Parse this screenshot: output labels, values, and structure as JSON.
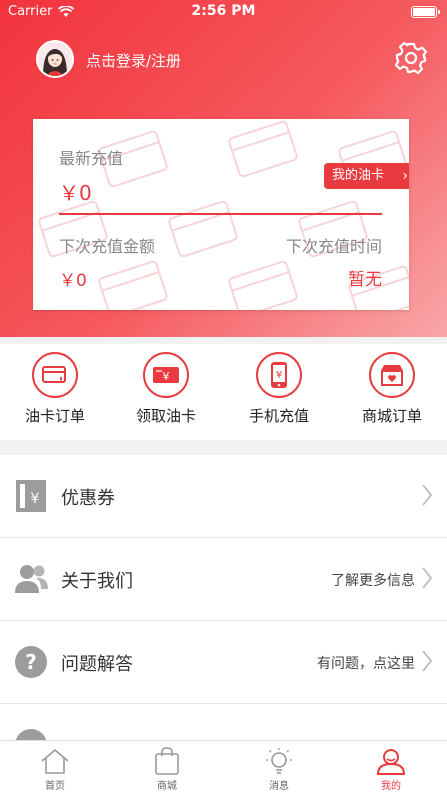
{
  "status_bar": {
    "carrier": "Carrier",
    "time": "2:56 PM"
  },
  "profile": {
    "login_text": "点击登录/注册"
  },
  "card": {
    "latest_label": "最新充值",
    "latest_value": "￥0",
    "my_card_button": "我的油卡",
    "next_amount_label": "下次充值金额",
    "next_amount_value": "￥0",
    "next_time_label": "下次充值时间",
    "next_time_value": "暂无"
  },
  "quick_actions": [
    {
      "label": "油卡订单",
      "icon": "card-icon"
    },
    {
      "label": "领取油卡",
      "icon": "yen-card-icon"
    },
    {
      "label": "手机充值",
      "icon": "phone-icon"
    },
    {
      "label": "商城订单",
      "icon": "shop-icon"
    }
  ],
  "menu": [
    {
      "label": "优惠券",
      "right": "",
      "icon": "coupon-icon"
    },
    {
      "label": "关于我们",
      "right": "了解更多信息",
      "icon": "users-icon"
    },
    {
      "label": "问题解答",
      "right": "有问题，点这里",
      "icon": "question-icon"
    }
  ],
  "tabs": [
    {
      "label": "首页",
      "icon": "home-icon"
    },
    {
      "label": "商城",
      "icon": "bag-icon"
    },
    {
      "label": "消息",
      "icon": "bulb-icon"
    },
    {
      "label": "我的",
      "icon": "user-icon",
      "active": true
    }
  ],
  "colors": {
    "accent": "#e83a3f",
    "header_start": "#f2333c",
    "header_end": "#f9a7a9"
  }
}
